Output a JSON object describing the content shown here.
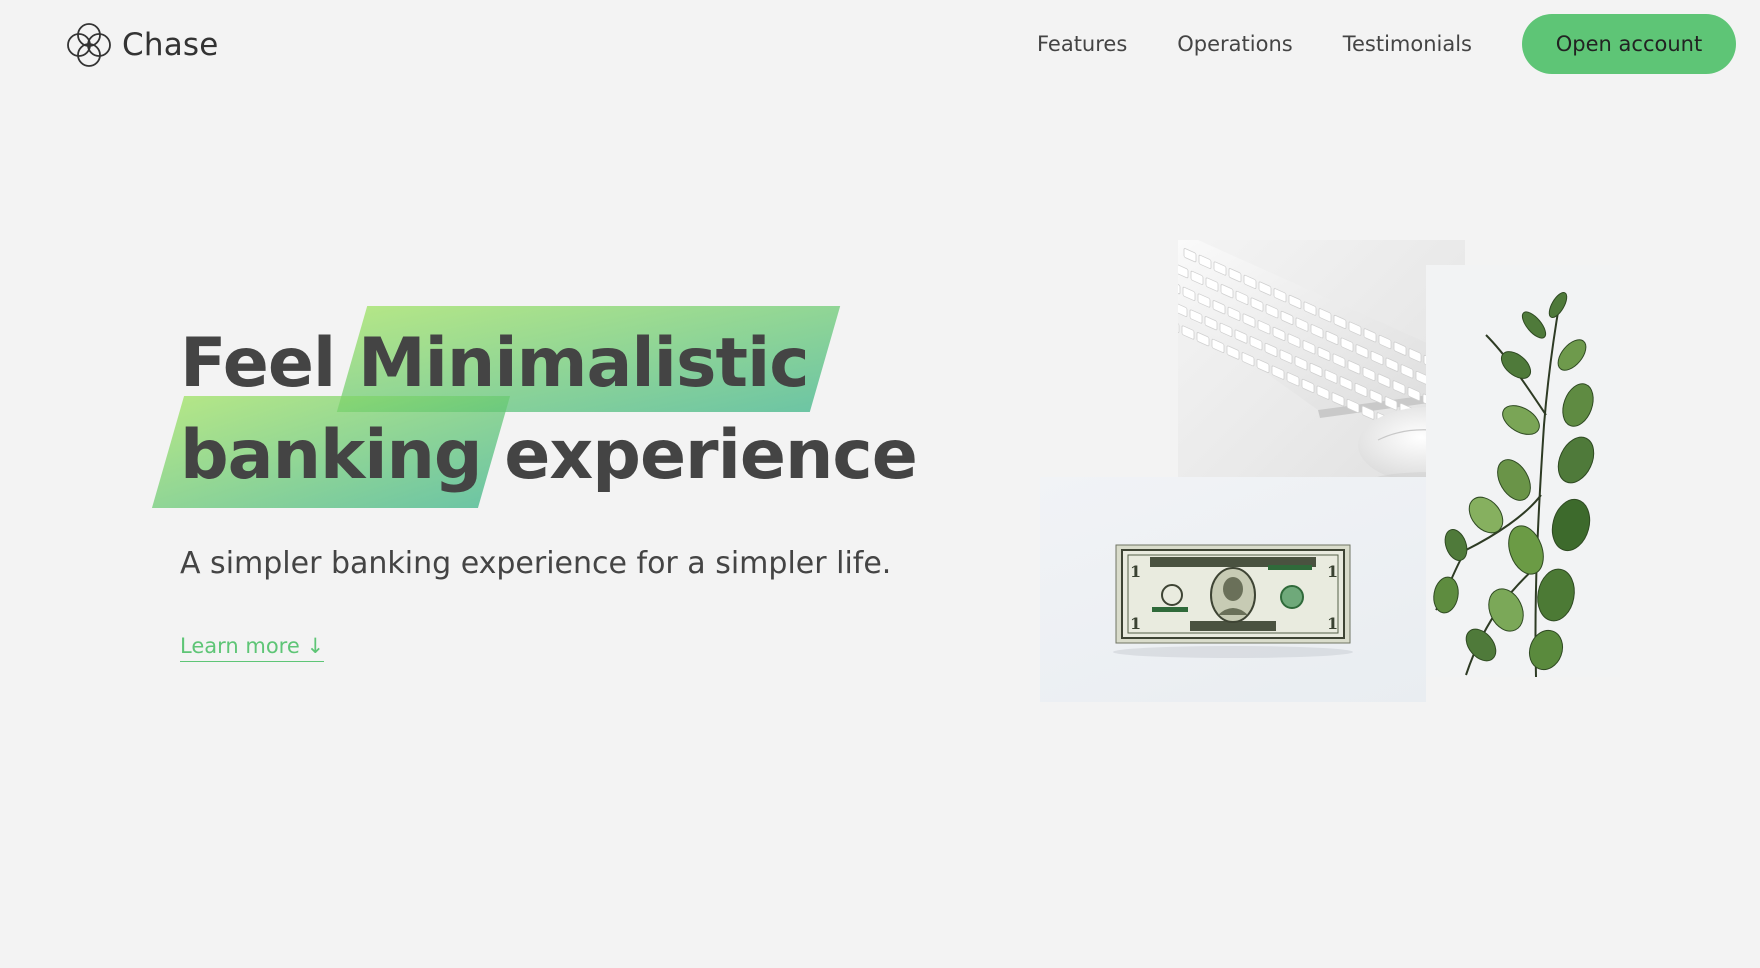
{
  "brand": {
    "name": "Chase",
    "logo_icon": "interlocking-circles-logo",
    "accent_color": "#5ec576",
    "gradient_colors": [
      "#39b385",
      "#9be15d"
    ]
  },
  "nav": {
    "links": [
      {
        "label": "Features"
      },
      {
        "label": "Operations"
      },
      {
        "label": "Testimonials"
      }
    ],
    "cta_label": "Open account"
  },
  "hero": {
    "title_word_1": "Feel",
    "title_highlight_1": "Minimalistic",
    "title_highlight_2": "banking",
    "title_word_2": "experience",
    "subtitle": "A simpler banking experience for a simpler life.",
    "learn_more": "Learn more ↓",
    "images": [
      {
        "name": "keyboard-and-mouse-photo"
      },
      {
        "name": "eucalyptus-plant-photo"
      },
      {
        "name": "one-dollar-bill-photo"
      }
    ]
  }
}
